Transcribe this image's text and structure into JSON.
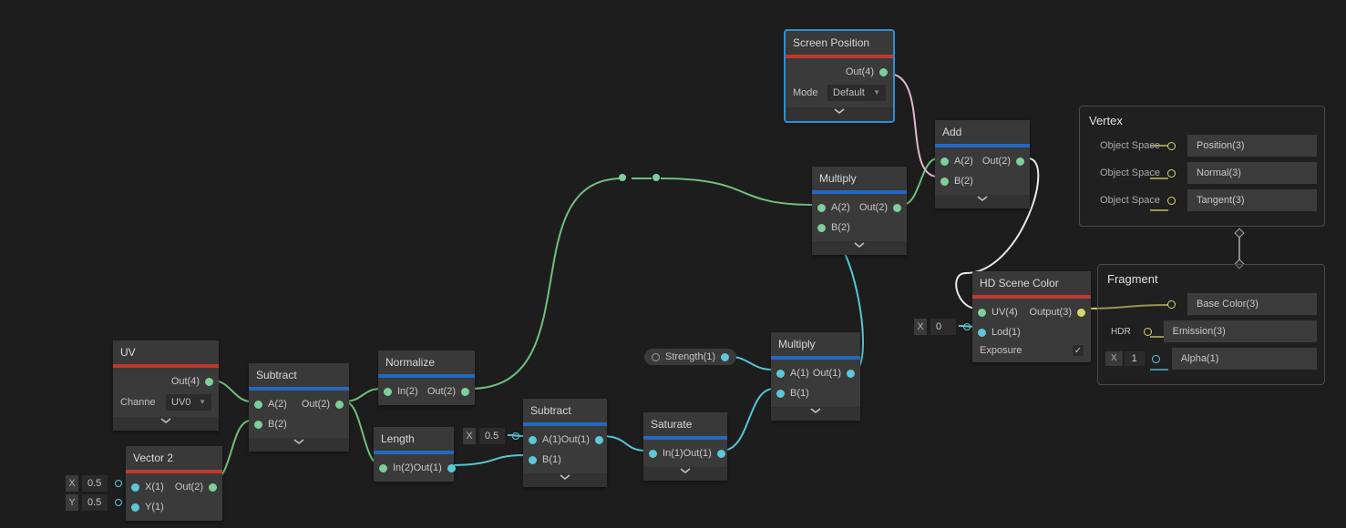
{
  "float_inputs": {
    "vec2_x": {
      "label": "X",
      "value": "0.5"
    },
    "vec2_y": {
      "label": "Y",
      "value": "0.5"
    },
    "subtract2_a": {
      "label": "X",
      "value": "0.5"
    },
    "hdscene_x": {
      "label": "X",
      "value": "0"
    }
  },
  "pill": {
    "strength_label": "Strength(1)"
  },
  "masters": {
    "vertex": {
      "title": "Vertex",
      "tags": [
        "Object Space",
        "Object Space",
        "Object Space"
      ],
      "slots": [
        "Position(3)",
        "Normal(3)",
        "Tangent(3)"
      ]
    },
    "fragment": {
      "title": "Fragment",
      "tags": {
        "hdr": "HDR",
        "x": "X",
        "xv": "1"
      },
      "slots": [
        "Base Color(3)",
        "Emission(3)",
        "Alpha(1)"
      ]
    }
  },
  "nodes": {
    "uv": {
      "title": "UV",
      "out": "Out(4)",
      "channel_label": "Channe",
      "channel_value": "UV0"
    },
    "vector2": {
      "title": "Vector 2",
      "out": "Out(2)",
      "x": "X(1)",
      "y": "Y(1)"
    },
    "subtract1": {
      "title": "Subtract",
      "a": "A(2)",
      "b": "B(2)",
      "out": "Out(2)"
    },
    "normalize": {
      "title": "Normalize",
      "in": "In(2)",
      "out": "Out(2)"
    },
    "length": {
      "title": "Length",
      "in": "In(2)",
      "out": "Out(1)"
    },
    "subtract2": {
      "title": "Subtract",
      "a": "A(1)",
      "b": "B(1)",
      "out": "Out(1)"
    },
    "saturate": {
      "title": "Saturate",
      "in": "In(1)",
      "out": "Out(1)"
    },
    "multiply2": {
      "title": "Multiply",
      "a": "A(1)",
      "b": "B(1)",
      "out": "Out(1)"
    },
    "multiply1": {
      "title": "Multiply",
      "a": "A(2)",
      "b": "B(2)",
      "out": "Out(2)"
    },
    "add": {
      "title": "Add",
      "a": "A(2)",
      "b": "B(2)",
      "out": "Out(2)"
    },
    "screenpos": {
      "title": "Screen Position",
      "out": "Out(4)",
      "mode_label": "Mode",
      "mode_value": "Default"
    },
    "hdscene": {
      "title": "HD Scene Color",
      "uv": "UV(4)",
      "lod": "Lod(1)",
      "exposure": "Exposure",
      "out": "Output(3)"
    }
  }
}
